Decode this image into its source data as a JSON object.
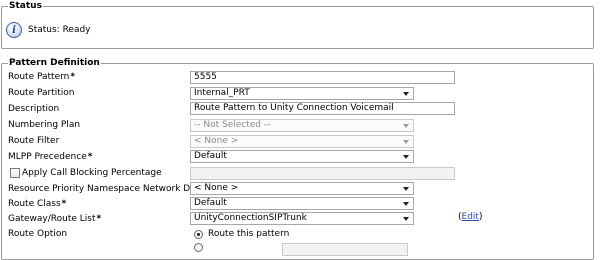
{
  "status": {
    "legend": "Status",
    "text": "Status: Ready",
    "icon": "info-icon"
  },
  "pattern_definition": {
    "legend": "Pattern Definition",
    "route_pattern": {
      "label": "Route Pattern",
      "required": "*",
      "value": "5555"
    },
    "route_partition": {
      "label": "Route Partition",
      "value": "Internal_PRT"
    },
    "description": {
      "label": "Description",
      "value": "Route Pattern to Unity Connection Voicemail"
    },
    "numbering_plan": {
      "label": "Numbering Plan",
      "value": "-- Not Selected --"
    },
    "route_filter": {
      "label": "Route Filter",
      "value": "< None >"
    },
    "mlpp_precedence": {
      "label": "MLPP Precedence",
      "required": "*",
      "value": "Default"
    },
    "call_blocking": {
      "label": "Apply Call Blocking Percentage",
      "checked": false
    },
    "resource_priority": {
      "label": "Resource Priority Namespace Network Domain",
      "value": "< None >"
    },
    "route_class": {
      "label": "Route Class",
      "required": "*",
      "value": "Default"
    },
    "gateway_route_list": {
      "label": "Gateway/Route List",
      "required": "*",
      "value": "UnityConnectionSIPTrunk",
      "edit_link": "Edit",
      "paren_open": "(",
      "paren_close": ")"
    },
    "route_option": {
      "label": "Route Option",
      "option_route": "Route this pattern"
    }
  }
}
